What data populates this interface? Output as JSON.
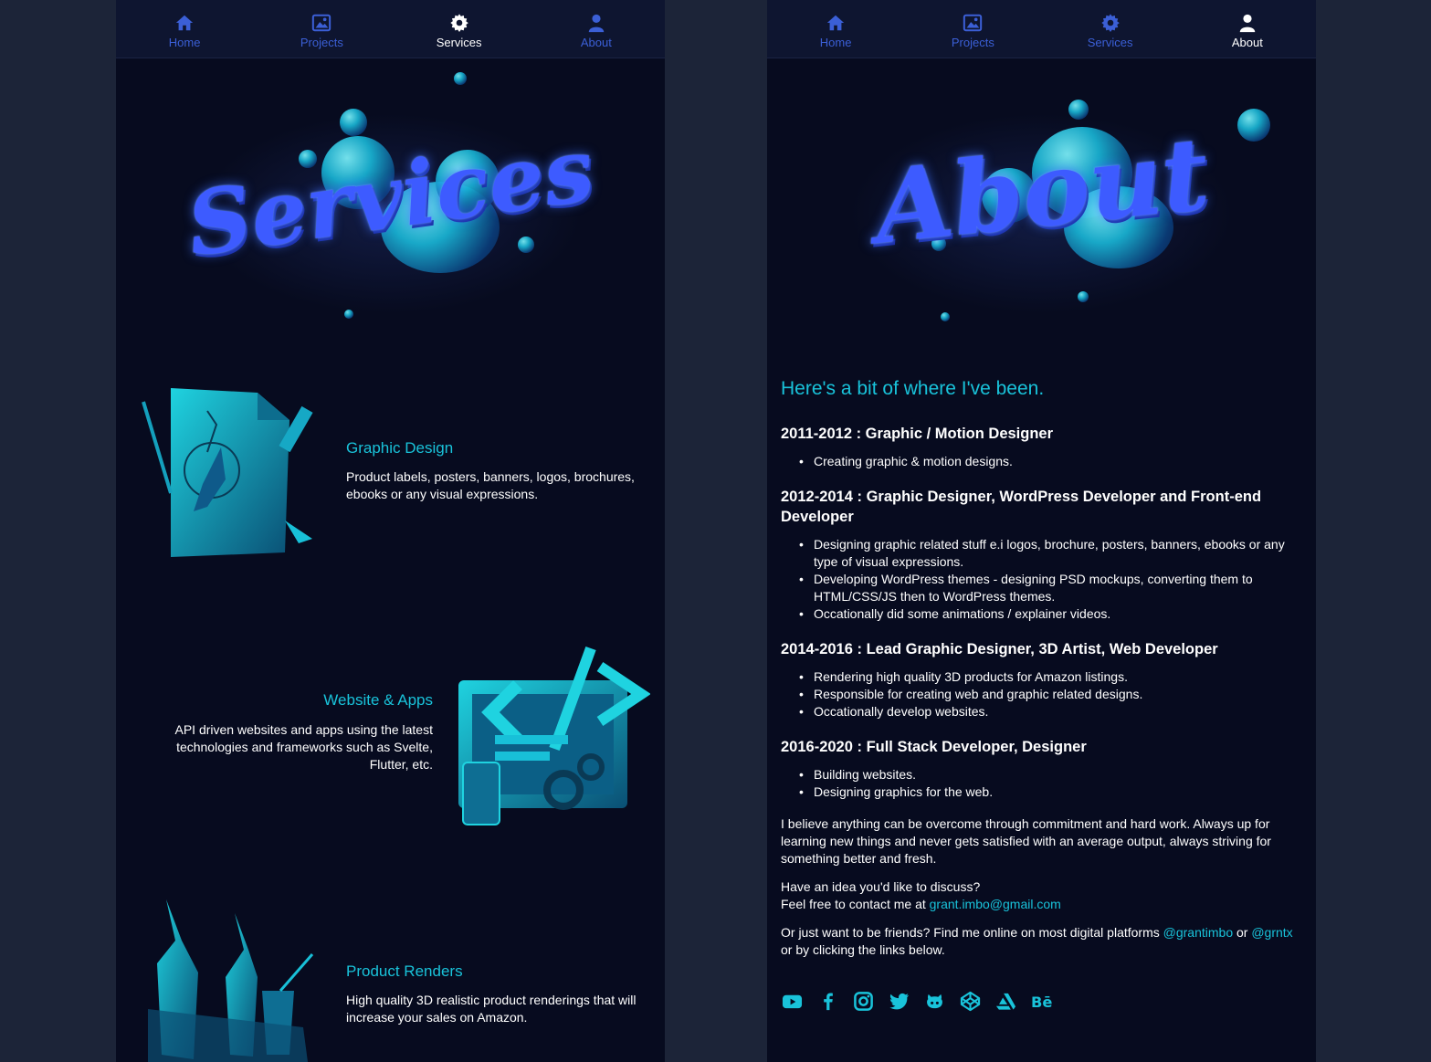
{
  "colors": {
    "accent": "#19c3da",
    "nav_inactive": "#3b5fd6",
    "panel_bg": "#070b1f",
    "page_bg": "#1c2438"
  },
  "left": {
    "nav": [
      {
        "label": "Home",
        "icon": "home-icon"
      },
      {
        "label": "Projects",
        "icon": "image-icon"
      },
      {
        "label": "Services",
        "icon": "gear-icon",
        "active": true
      },
      {
        "label": "About",
        "icon": "user-icon"
      }
    ],
    "hero_title": "Services",
    "services": [
      {
        "title": "Graphic Design",
        "desc": "Product labels, posters, banners, logos, brochures, ebooks or any visual expressions.",
        "illustration": "pen-tool-illustration"
      },
      {
        "title": "Website & Apps",
        "desc": "API driven websites and apps using the latest technologies and frameworks such as Svelte, Flutter, etc.",
        "illustration": "code-monitor-illustration"
      },
      {
        "title": "Product Renders",
        "desc": "High quality 3D realistic product renderings that will increase your sales on Amazon.",
        "illustration": "bottles-illustration"
      }
    ]
  },
  "right": {
    "nav": [
      {
        "label": "Home",
        "icon": "home-icon"
      },
      {
        "label": "Projects",
        "icon": "image-icon"
      },
      {
        "label": "Services",
        "icon": "gear-icon"
      },
      {
        "label": "About",
        "icon": "user-icon",
        "active": true
      }
    ],
    "hero_title": "About",
    "heading": "Here's a bit of where I've been.",
    "jobs": [
      {
        "title": "2011-2012 : Graphic / Motion Designer",
        "items": [
          "Creating graphic & motion designs."
        ]
      },
      {
        "title": "2012-2014 : Graphic Designer, WordPress Developer and Front-end Developer",
        "items": [
          "Designing graphic related stuff e.i logos, brochure, posters, banners, ebooks or any type of visual expressions.",
          "Developing WordPress themes - designing PSD mockups, converting them to HTML/CSS/JS then to WordPress themes.",
          "Occationally did some animations / explainer videos."
        ]
      },
      {
        "title": "2014-2016 : Lead Graphic Designer, 3D Artist, Web Developer",
        "items": [
          "Rendering high quality 3D products for Amazon listings.",
          "Responsible for creating web and graphic related designs.",
          "Occationally develop websites."
        ]
      },
      {
        "title": "2016-2020 : Full Stack Developer, Designer",
        "items": [
          "Building websites.",
          "Designing graphics for the web."
        ]
      }
    ],
    "belief": "I believe anything can be overcome through commitment and hard work. Always up for learning new things and never gets satisfied with an average output, always striving for something better and fresh.",
    "contact_line1": "Have an idea you'd like to discuss?",
    "contact_line2": "Feel free to contact me at ",
    "email": "grant.imbo@gmail.com",
    "friends_text1": "Or just want to be friends? Find me online on most digital platforms ",
    "handle1": "@grantimbo",
    "friends_or": "or ",
    "handle2": "@grntx",
    "friends_text2": " or by clicking the links below.",
    "socials": [
      "youtube-icon",
      "facebook-icon",
      "instagram-icon",
      "twitter-icon",
      "github-icon",
      "codepen-icon",
      "artstation-icon",
      "behance-icon"
    ]
  }
}
